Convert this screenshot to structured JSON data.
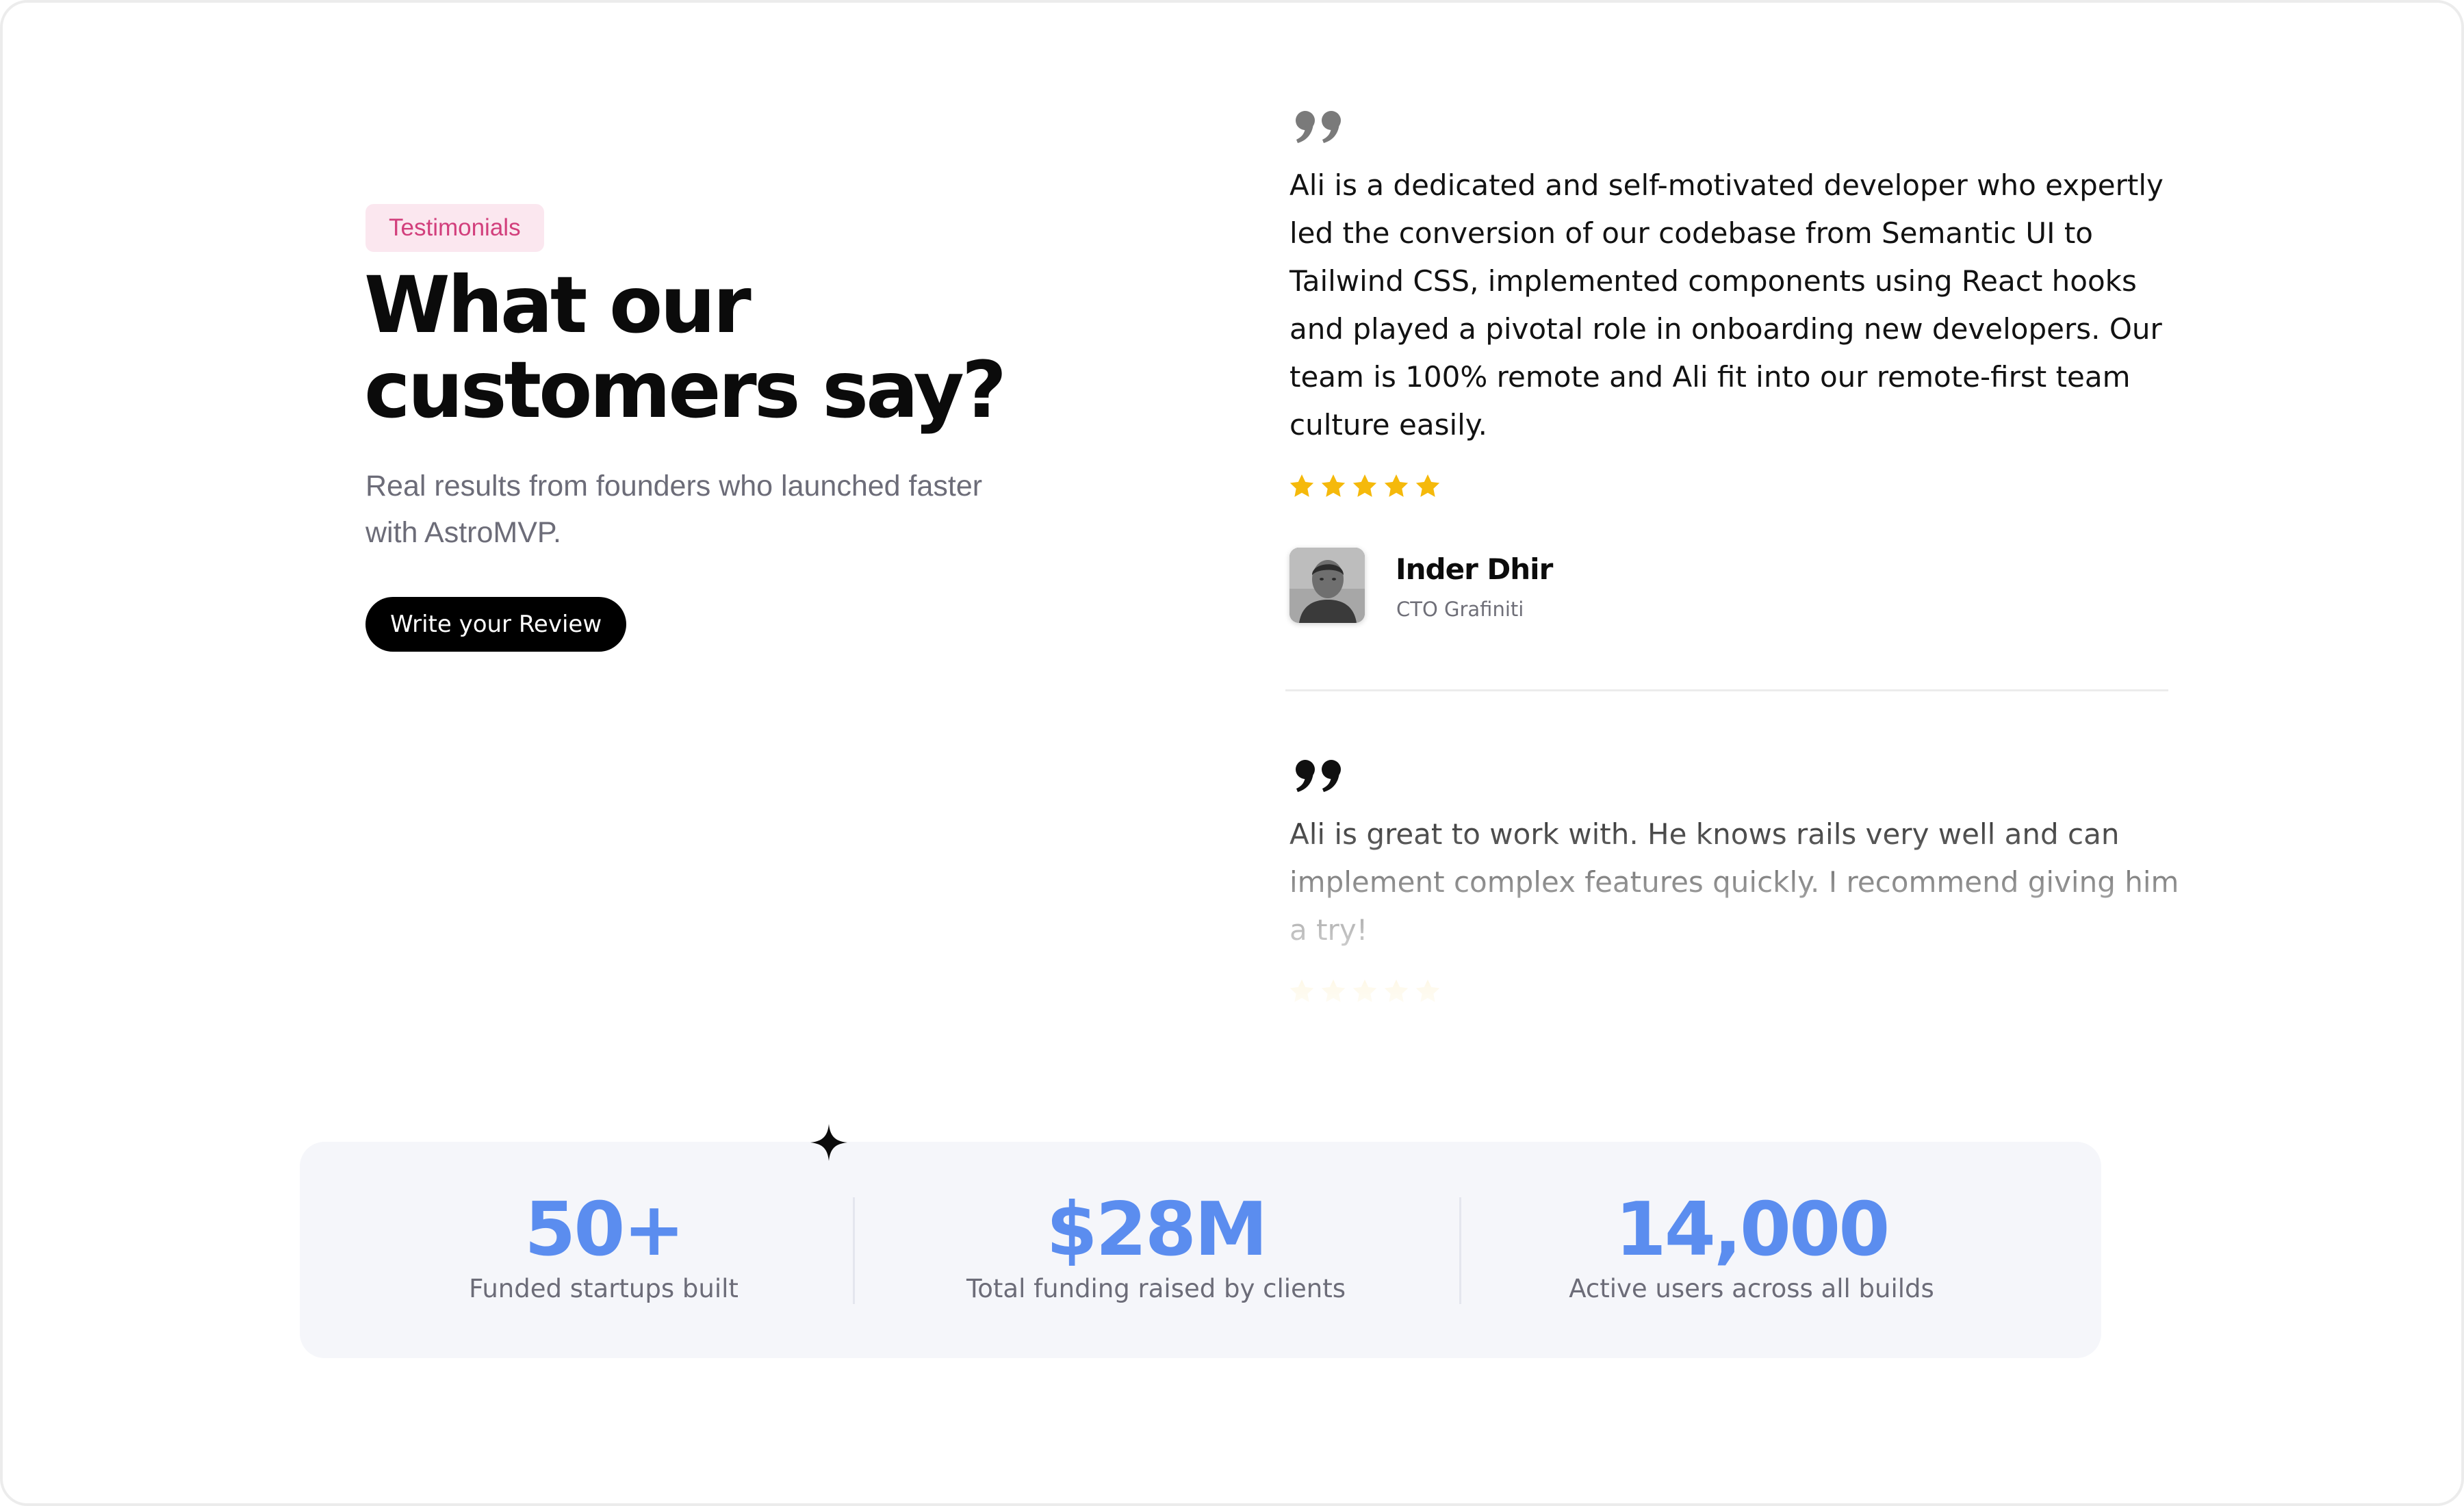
{
  "hero": {
    "badge": "Testimonials",
    "title_line1": "What our",
    "title_line2": "customers say?",
    "subtitle_line1": "Real results from founders who launched faster",
    "subtitle_line2": "with AstroMVP.",
    "cta_label": "Write your Review"
  },
  "testimonials": [
    {
      "quote": "Ali is a dedicated and self-motivated developer who expertly led the conversion of our codebase from Semantic UI to Tailwind CSS, implemented components using React hooks and played a pivotal role in onboarding new developers. Our team is 100% remote and Ali fit into our remote-first team culture easily.",
      "rating": 5,
      "author_name": "Inder Dhir",
      "author_role": "CTO Grafiniti"
    },
    {
      "quote": "Ali is great to work with. He knows rails very well and can implement complex features quickly. I recommend giving him a try!",
      "rating": 5
    }
  ],
  "stats": [
    {
      "value": "50+",
      "label": "Funded startups built"
    },
    {
      "value": "$28M",
      "label": "Total funding raised by clients"
    },
    {
      "value": "14,000",
      "label": "Active users across all builds"
    }
  ],
  "colors": {
    "accent_blue": "#5b8def",
    "badge_pink": "#d23f7c",
    "badge_bg": "#fbe7ef",
    "star_yellow": "#f5b90b",
    "stats_bg": "#f5f6fa"
  },
  "icons": {
    "quote": "quote-icon",
    "star": "star-icon",
    "sparkle": "sparkle-icon"
  }
}
